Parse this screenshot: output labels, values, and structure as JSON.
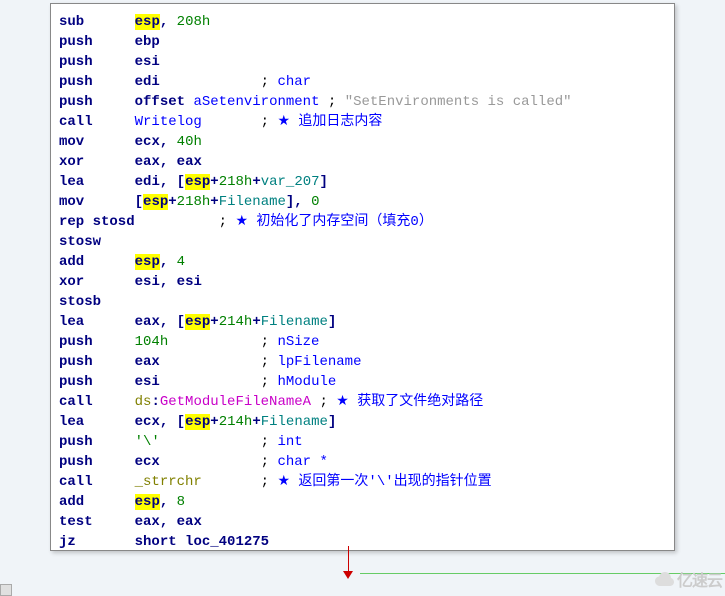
{
  "code": {
    "lines": [
      {
        "mnemonic": "sub",
        "pad": 6,
        "ops": [
          {
            "t": "esp",
            "c": "hl"
          },
          {
            "t": ", ",
            "c": "navy"
          },
          {
            "t": "208h",
            "c": "green"
          }
        ]
      },
      {
        "mnemonic": "push",
        "pad": 5,
        "ops": [
          {
            "t": "ebp",
            "c": "navy"
          }
        ]
      },
      {
        "mnemonic": "push",
        "pad": 5,
        "ops": [
          {
            "t": "esi",
            "c": "navy"
          }
        ]
      },
      {
        "mnemonic": "push",
        "pad": 5,
        "ops": [
          {
            "t": "edi",
            "c": "navy"
          },
          {
            "t": "            ; ",
            "c": "black"
          },
          {
            "t": "char",
            "c": "blue"
          }
        ]
      },
      {
        "mnemonic": "push",
        "pad": 5,
        "ops": [
          {
            "t": "offset",
            "c": "navy"
          },
          {
            "t": " ",
            "c": "black"
          },
          {
            "t": "aSetenvironment",
            "c": "blue"
          },
          {
            "t": " ; ",
            "c": "black"
          },
          {
            "t": "\"SetEnvironments is called\"",
            "c": "gray"
          }
        ]
      },
      {
        "mnemonic": "call",
        "pad": 5,
        "ops": [
          {
            "t": "Writelog",
            "c": "blue"
          },
          {
            "t": "       ; ",
            "c": "black"
          },
          {
            "t": "★",
            "c": "star"
          },
          {
            "t": " 追加日志内容",
            "c": "blue"
          }
        ]
      },
      {
        "mnemonic": "mov",
        "pad": 6,
        "ops": [
          {
            "t": "ecx",
            "c": "navy"
          },
          {
            "t": ", ",
            "c": "navy"
          },
          {
            "t": "40h",
            "c": "green"
          }
        ]
      },
      {
        "mnemonic": "xor",
        "pad": 6,
        "ops": [
          {
            "t": "eax",
            "c": "navy"
          },
          {
            "t": ", ",
            "c": "navy"
          },
          {
            "t": "eax",
            "c": "navy"
          }
        ]
      },
      {
        "mnemonic": "lea",
        "pad": 6,
        "ops": [
          {
            "t": "edi",
            "c": "navy"
          },
          {
            "t": ", [",
            "c": "navy"
          },
          {
            "t": "esp",
            "c": "hl"
          },
          {
            "t": "+",
            "c": "navy"
          },
          {
            "t": "218h",
            "c": "green"
          },
          {
            "t": "+",
            "c": "navy"
          },
          {
            "t": "var_207",
            "c": "teal"
          },
          {
            "t": "]",
            "c": "navy"
          }
        ]
      },
      {
        "mnemonic": "mov",
        "pad": 6,
        "ops": [
          {
            "t": "[",
            "c": "navy"
          },
          {
            "t": "esp",
            "c": "hl"
          },
          {
            "t": "+",
            "c": "navy"
          },
          {
            "t": "218h",
            "c": "green"
          },
          {
            "t": "+",
            "c": "navy"
          },
          {
            "t": "Filename",
            "c": "teal"
          },
          {
            "t": "], ",
            "c": "navy"
          },
          {
            "t": "0",
            "c": "green"
          }
        ]
      },
      {
        "mnemonic": "rep stosd",
        "pad": 0,
        "ops": [
          {
            "t": "          ; ",
            "c": "black"
          },
          {
            "t": "★",
            "c": "star"
          },
          {
            "t": " 初始化了内存空间（填充0）",
            "c": "blue"
          }
        ]
      },
      {
        "mnemonic": "stosw",
        "pad": 0,
        "ops": []
      },
      {
        "mnemonic": "add",
        "pad": 6,
        "ops": [
          {
            "t": "esp",
            "c": "hl"
          },
          {
            "t": ", ",
            "c": "navy"
          },
          {
            "t": "4",
            "c": "green"
          }
        ]
      },
      {
        "mnemonic": "xor",
        "pad": 6,
        "ops": [
          {
            "t": "esi",
            "c": "navy"
          },
          {
            "t": ", ",
            "c": "navy"
          },
          {
            "t": "esi",
            "c": "navy"
          }
        ]
      },
      {
        "mnemonic": "stosb",
        "pad": 0,
        "ops": []
      },
      {
        "mnemonic": "lea",
        "pad": 6,
        "ops": [
          {
            "t": "eax",
            "c": "navy"
          },
          {
            "t": ", [",
            "c": "navy"
          },
          {
            "t": "esp",
            "c": "hl"
          },
          {
            "t": "+",
            "c": "navy"
          },
          {
            "t": "214h",
            "c": "green"
          },
          {
            "t": "+",
            "c": "navy"
          },
          {
            "t": "Filename",
            "c": "teal"
          },
          {
            "t": "]",
            "c": "navy"
          }
        ]
      },
      {
        "mnemonic": "push",
        "pad": 5,
        "ops": [
          {
            "t": "104h",
            "c": "green"
          },
          {
            "t": "           ; ",
            "c": "black"
          },
          {
            "t": "nSize",
            "c": "blue"
          }
        ]
      },
      {
        "mnemonic": "push",
        "pad": 5,
        "ops": [
          {
            "t": "eax",
            "c": "navy"
          },
          {
            "t": "            ; ",
            "c": "black"
          },
          {
            "t": "lpFilename",
            "c": "blue"
          }
        ]
      },
      {
        "mnemonic": "push",
        "pad": 5,
        "ops": [
          {
            "t": "esi",
            "c": "navy"
          },
          {
            "t": "            ; ",
            "c": "black"
          },
          {
            "t": "hModule",
            "c": "blue"
          }
        ]
      },
      {
        "mnemonic": "call",
        "pad": 5,
        "ops": [
          {
            "t": "ds",
            "c": "olive"
          },
          {
            "t": ":",
            "c": "navy"
          },
          {
            "t": "GetModuleFileNameA",
            "c": "magenta"
          },
          {
            "t": " ; ",
            "c": "black"
          },
          {
            "t": "★",
            "c": "star"
          },
          {
            "t": " 获取了文件绝对路径",
            "c": "blue"
          }
        ]
      },
      {
        "mnemonic": "lea",
        "pad": 6,
        "ops": [
          {
            "t": "ecx",
            "c": "navy"
          },
          {
            "t": ", [",
            "c": "navy"
          },
          {
            "t": "esp",
            "c": "hl"
          },
          {
            "t": "+",
            "c": "navy"
          },
          {
            "t": "214h",
            "c": "green"
          },
          {
            "t": "+",
            "c": "navy"
          },
          {
            "t": "Filename",
            "c": "teal"
          },
          {
            "t": "]",
            "c": "navy"
          }
        ]
      },
      {
        "mnemonic": "push",
        "pad": 5,
        "ops": [
          {
            "t": "'\\'",
            "c": "green"
          },
          {
            "t": "            ; ",
            "c": "black"
          },
          {
            "t": "int",
            "c": "blue"
          }
        ]
      },
      {
        "mnemonic": "push",
        "pad": 5,
        "ops": [
          {
            "t": "ecx",
            "c": "navy"
          },
          {
            "t": "            ; ",
            "c": "black"
          },
          {
            "t": "char *",
            "c": "blue"
          }
        ]
      },
      {
        "mnemonic": "call",
        "pad": 5,
        "ops": [
          {
            "t": "_strrchr",
            "c": "olive"
          },
          {
            "t": "       ; ",
            "c": "black"
          },
          {
            "t": "★",
            "c": "star"
          },
          {
            "t": " 返回第一次'\\'出现的指针位置",
            "c": "blue"
          }
        ]
      },
      {
        "mnemonic": "add",
        "pad": 6,
        "ops": [
          {
            "t": "esp",
            "c": "hl"
          },
          {
            "t": ", ",
            "c": "navy"
          },
          {
            "t": "8",
            "c": "green"
          }
        ]
      },
      {
        "mnemonic": "test",
        "pad": 5,
        "ops": [
          {
            "t": "eax",
            "c": "navy"
          },
          {
            "t": ", ",
            "c": "navy"
          },
          {
            "t": "eax",
            "c": "navy"
          }
        ]
      },
      {
        "mnemonic": "jz",
        "pad": 7,
        "ops": [
          {
            "t": "short",
            "c": "navy"
          },
          {
            "t": " ",
            "c": "black"
          },
          {
            "t": "loc_401275",
            "c": "navy"
          }
        ]
      }
    ]
  },
  "watermark": "亿速云"
}
